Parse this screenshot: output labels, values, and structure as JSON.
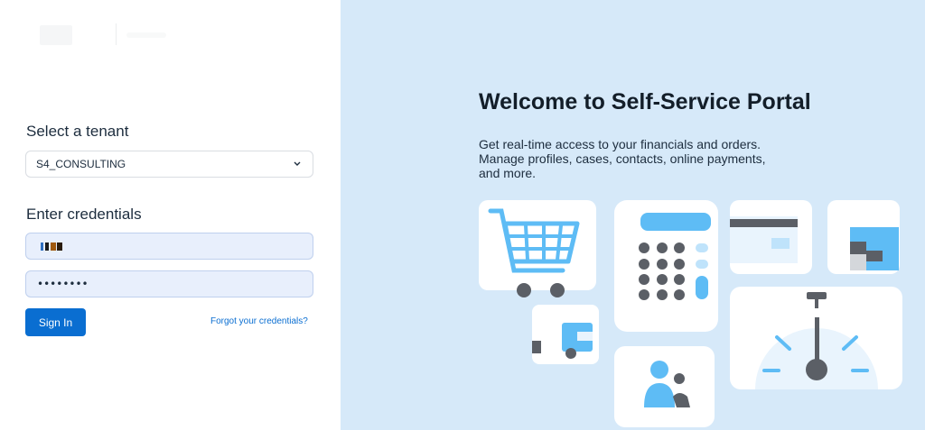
{
  "login": {
    "tenant_heading": "Select a tenant",
    "tenant_selected": "S4_CONSULTING",
    "credentials_heading": "Enter credentials",
    "password_masked": "••••••••",
    "sign_in_label": "Sign In",
    "forgot_label": "Forgot your credentials?"
  },
  "welcome": {
    "title": "Welcome to Self-Service Portal",
    "description_line1": "Get real-time access to your financials and orders.",
    "description_line2": "Manage profiles, cases, contacts, online payments,",
    "description_line3": "and more."
  },
  "colors": {
    "accent": "#0a6ed1",
    "right_panel_bg": "#d6e9f9",
    "illustration_blue": "#5ebcf5",
    "illustration_gray": "#5b5f66"
  },
  "icons": [
    "company-logo",
    "chevron-down-icon",
    "shopping-cart-icon",
    "calculator-icon",
    "credit-card-icon",
    "chart-tile-icon",
    "delivery-truck-icon",
    "contacts-icon",
    "stopwatch-icon"
  ]
}
